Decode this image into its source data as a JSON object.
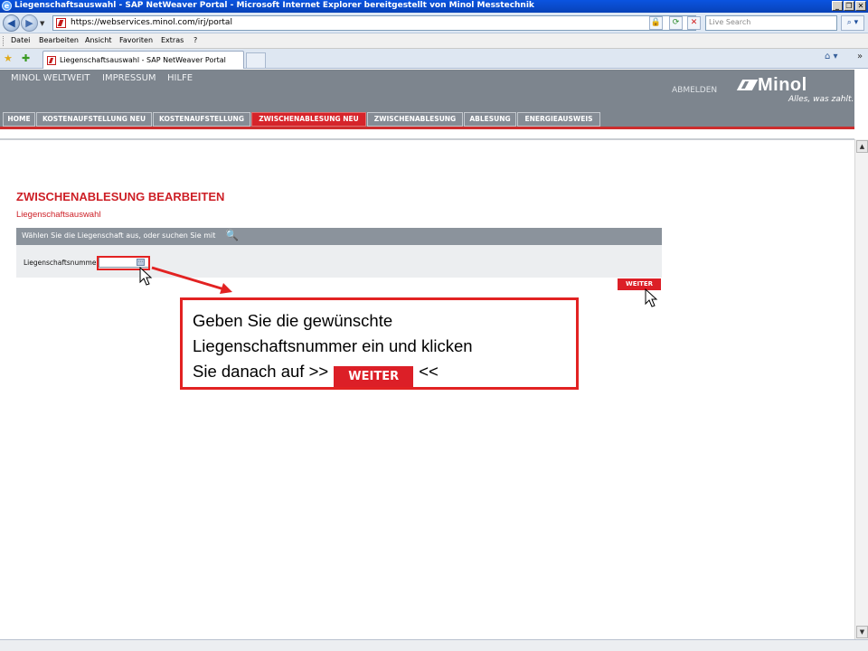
{
  "window": {
    "title": "Liegenschaftsauswahl - SAP NetWeaver Portal - Microsoft Internet Explorer bereitgestellt von Minol Messtechnik",
    "buttons": [
      "_",
      "❐",
      "✕"
    ]
  },
  "address_bar": {
    "url": "https://webservices.minol.com/irj/portal",
    "search_placeholder": "Live Search"
  },
  "menu": [
    "Datei",
    "Bearbeiten",
    "Ansicht",
    "Favoriten",
    "Extras",
    "?"
  ],
  "browser_tab": {
    "label": "Liegenschaftsauswahl - SAP NetWeaver Portal"
  },
  "portal": {
    "header_links": [
      "MINOL WELTWEIT",
      "IMPRESSUM",
      "HILFE"
    ],
    "logout": "ABMELDEN",
    "logo_name": "Minol",
    "logo_slogan": "Alles, was zahlt."
  },
  "nav_tabs": [
    {
      "label": "HOME",
      "active": false
    },
    {
      "label": "KOSTENAUFSTELLUNG NEU",
      "active": false
    },
    {
      "label": "KOSTENAUFSTELLUNG",
      "active": false
    },
    {
      "label": "ZWISCHENABLESUNG NEU",
      "active": true
    },
    {
      "label": "ZWISCHENABLESUNG",
      "active": false
    },
    {
      "label": "ABLESUNG",
      "active": false
    },
    {
      "label": "ENERGIEAUSWEIS",
      "active": false
    }
  ],
  "content": {
    "title": "ZWISCHENABLESUNG BEARBEITEN",
    "subtitle": "Liegenschaftsauswahl",
    "panel_header": "Wählen Sie die Liegenschaft aus, oder suchen Sie mit",
    "field_label": "Liegenschaftsnummer",
    "field_value": "",
    "weiter_label": "WEITER"
  },
  "callout": {
    "line1": "Geben Sie die gewünschte",
    "line2": "Liegenschaftsnummer ein und klicken",
    "line3_prefix": "Sie danach auf >>",
    "button": "WEITER",
    "line3_suffix": "<<"
  },
  "colors": {
    "brand_red": "#dc1f27",
    "header_gray": "#7d858e",
    "annotation_red": "#e22222"
  }
}
